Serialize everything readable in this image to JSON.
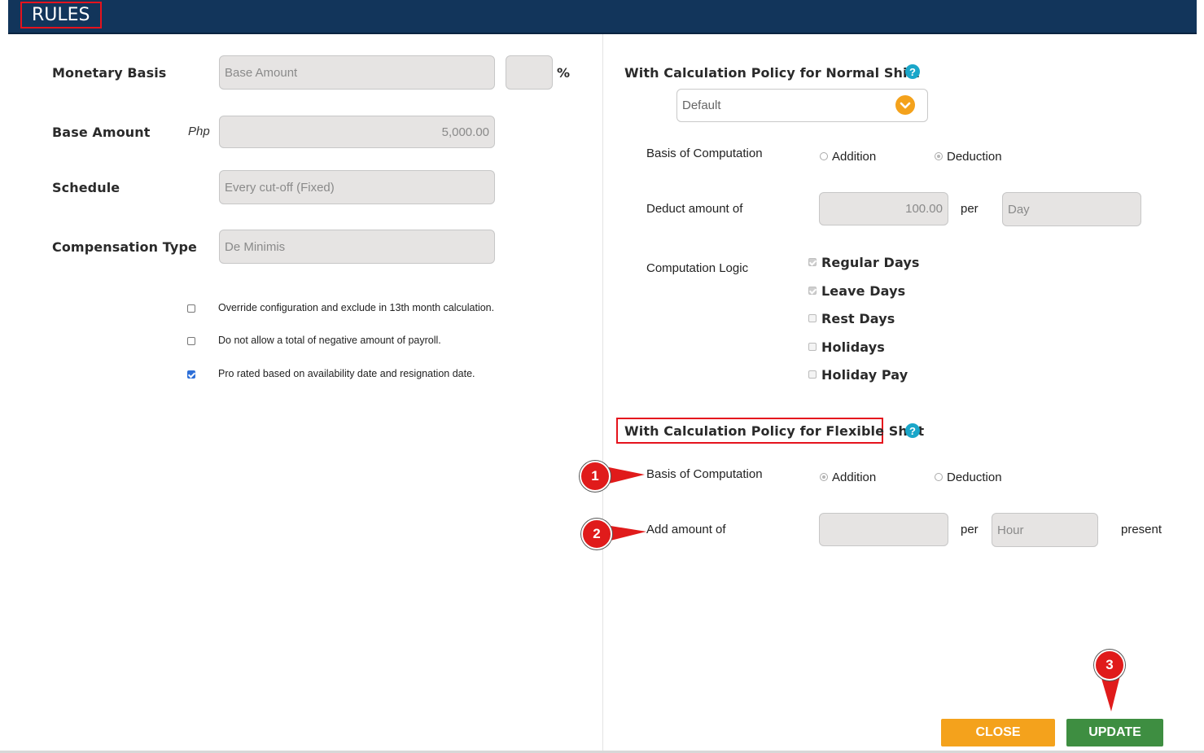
{
  "header": {
    "title": "RULES"
  },
  "left": {
    "monetary_basis": {
      "label": "Monetary Basis",
      "value": "Base Amount",
      "percent_value": "",
      "percent_symbol": "%"
    },
    "base_amount": {
      "label": "Base Amount",
      "currency": "Php",
      "value": "5,000.00"
    },
    "schedule": {
      "label": "Schedule",
      "value": "Every cut-off (Fixed)"
    },
    "compensation_type": {
      "label": "Compensation Type",
      "value": "De Minimis"
    },
    "options": [
      {
        "label": "Override configuration and exclude in 13th month calculation.",
        "checked": false
      },
      {
        "label": "Do not allow a total of negative amount of payroll.",
        "checked": false
      },
      {
        "label": "Pro rated based on availability date and resignation date.",
        "checked": true
      }
    ]
  },
  "normal": {
    "title": "With Calculation Policy for Normal Shift",
    "policy_value": "Default",
    "basis_label": "Basis of Computation",
    "addition_label": "Addition",
    "deduction_label": "Deduction",
    "selected": "Deduction",
    "amount_label": "Deduct amount of",
    "amount_value": "100.00",
    "per_label": "per",
    "unit_value": "Day",
    "logic_label": "Computation Logic",
    "logic_items": [
      {
        "label": "Regular Days",
        "checked": true
      },
      {
        "label": "Leave Days",
        "checked": true
      },
      {
        "label": "Rest Days",
        "checked": false
      },
      {
        "label": "Holidays",
        "checked": false
      },
      {
        "label": "Holiday Pay",
        "checked": false
      }
    ]
  },
  "flexible": {
    "title": "With Calculation Policy for Flexible Shift",
    "basis_label": "Basis of Computation",
    "addition_label": "Addition",
    "deduction_label": "Deduction",
    "selected": "Addition",
    "amount_label": "Add amount of",
    "amount_value": "",
    "per_label": "per",
    "unit_value": "Hour",
    "suffix": "present"
  },
  "markers": [
    "1",
    "2",
    "3"
  ],
  "buttons": {
    "close": "CLOSE",
    "update": "UPDATE"
  },
  "colors": {
    "header_bg": "#12355b",
    "highlight": "#e5131d",
    "close_btn": "#f4a21c",
    "update_btn": "#3e8e41",
    "help_icon": "#1aa6c9"
  }
}
